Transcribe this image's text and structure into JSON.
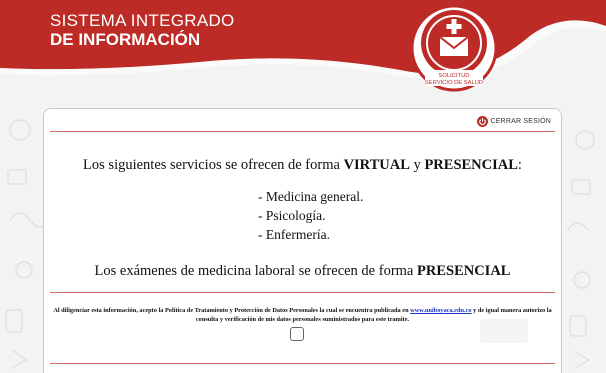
{
  "brand": {
    "line1": "SISTEMA INTEGRADO",
    "line2": "DE INFORMACIÓN"
  },
  "logo": {
    "label_line1": "SOLICITUD",
    "label_line2": "SERVICIO DE SALUD",
    "icon": "medical-envelope-icon"
  },
  "colors": {
    "brand_red": "#bd2b27",
    "link_blue": "#1a35c9"
  },
  "logout": {
    "label": "CERRAR SESIÓN",
    "icon": "power-icon"
  },
  "content": {
    "intro": {
      "prefix": "Los siguientes servicios se ofrecen de forma ",
      "mode1": "VIRTUAL",
      "conj": " y ",
      "mode2": "PRESENCIAL",
      "suffix": ":"
    },
    "services": [
      "- Medicina general.",
      "- Psicología.",
      "- Enfermería."
    ],
    "exams": {
      "prefix": "Los exámenes de medicina laboral se ofrecen de forma ",
      "mode": "PRESENCIAL"
    }
  },
  "policy": {
    "text_before": "Al diligenciar esta información, acepto la Política de Tratamiento y Protección de Datos Personales la cual se encuentra publicada en ",
    "link": "www.uniboyaca.edu.co",
    "text_after": " y de igual manera autorizo la consulta y verificación de mis datos personales suministrados para este tramite."
  }
}
